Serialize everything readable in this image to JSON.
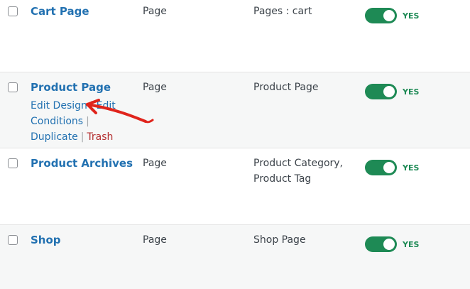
{
  "rows": [
    {
      "title": "Cart Page",
      "type": "Page",
      "conditions": [
        "Pages : cart"
      ],
      "status": "YES"
    },
    {
      "title": "Product Page",
      "type": "Page",
      "conditions": [
        "Product Page"
      ],
      "status": "YES",
      "actions": {
        "edit_design": "Edit Design",
        "edit_conditions_1": "Edit",
        "edit_conditions_2": "Conditions",
        "duplicate": "Duplicate",
        "trash": "Trash",
        "sep": "|"
      }
    },
    {
      "title": "Product Archives",
      "type": "Page",
      "conditions": [
        "Product Category,",
        "Product Tag"
      ],
      "status": "YES"
    },
    {
      "title": "Shop",
      "type": "Page",
      "conditions": [
        "Shop Page"
      ],
      "status": "YES"
    }
  ],
  "colors": {
    "link": "#2271b1",
    "toggle_on": "#1e8a55",
    "trash": "#b32d2e",
    "annotation_arrow": "#e0241c"
  },
  "icons": {
    "annotation": "red-arrow-icon"
  }
}
